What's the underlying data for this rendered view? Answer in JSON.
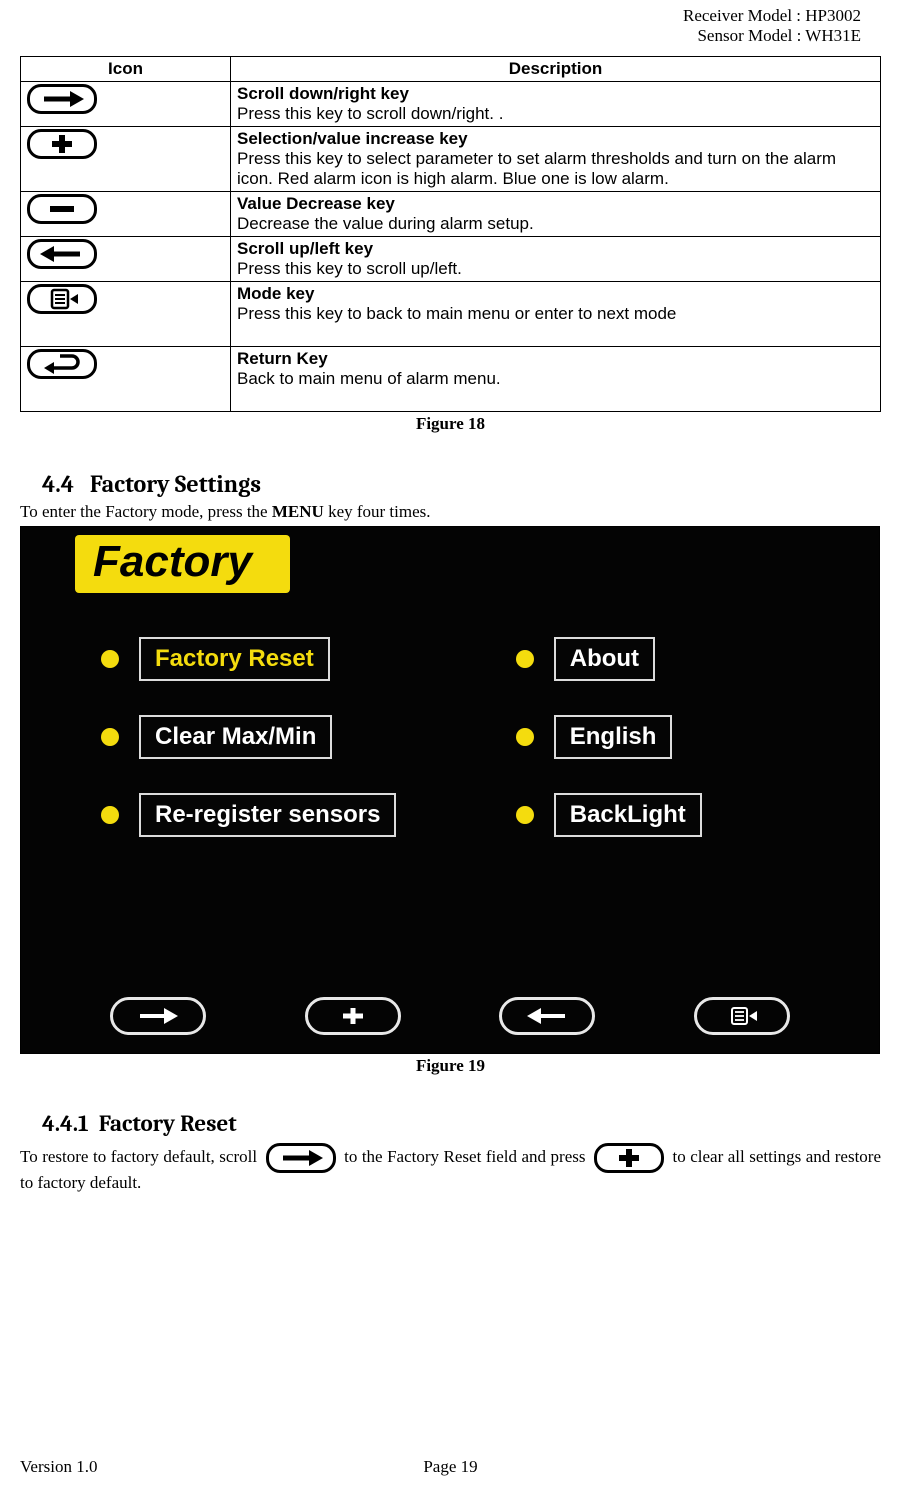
{
  "header": {
    "receiver": "Receiver Model : HP3002",
    "sensor": "Sensor Model : WH31E"
  },
  "table": {
    "headers": {
      "icon": "Icon",
      "desc": "Description"
    },
    "rows": [
      {
        "title": "Scroll down/right key",
        "desc": "Press this key to scroll down/right.    ."
      },
      {
        "title": "Selection/value increase key",
        "desc": "Press this key to select parameter to set alarm thresholds and turn on the alarm icon. Red alarm icon is high alarm. Blue one is low alarm."
      },
      {
        "title": "Value Decrease key",
        "desc": "Decrease the value during alarm setup."
      },
      {
        "title": "Scroll up/left key",
        "desc": "Press this key to scroll up/left."
      },
      {
        "title": "Mode key",
        "desc": "Press this key to back to main menu or enter to next mode"
      },
      {
        "title": "Return Key",
        "desc": "Back to main menu of alarm menu."
      }
    ]
  },
  "captions": {
    "fig18": "Figure 18",
    "fig19": "Figure 19"
  },
  "sections": {
    "s44_num": "4.4",
    "s44_title": "Factory Settings",
    "s44_intro_a": "To enter the Factory mode, press the ",
    "s44_intro_menu": "MENU",
    "s44_intro_b": " key four times.",
    "s441_num": "4.4.1",
    "s441_title": "Factory Reset",
    "s441_a": "To restore to factory default, scroll ",
    "s441_b": " to the Factory Reset field and press ",
    "s441_c": " to clear all settings and restore to factory default."
  },
  "screen": {
    "tab": "Factory",
    "col1": [
      "Factory Reset",
      "Clear Max/Min",
      "Re-register sensors"
    ],
    "col2": [
      "About",
      "English",
      "BackLight"
    ]
  },
  "footer": {
    "version": "Version 1.0",
    "page": "Page 19"
  }
}
